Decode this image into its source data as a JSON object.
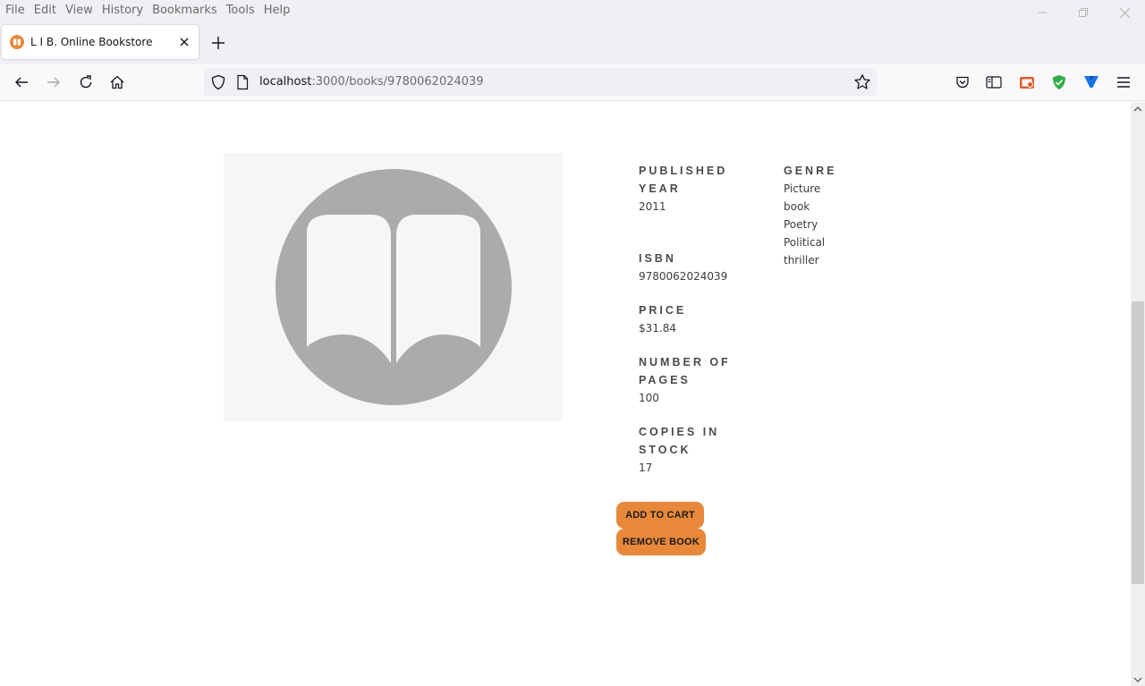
{
  "menu": [
    "File",
    "Edit",
    "View",
    "History",
    "Bookmarks",
    "Tools",
    "Help"
  ],
  "tab": {
    "title": "L I B. Online Bookstore"
  },
  "url": {
    "host": "localhost",
    "path": ":3000/books/9780062024039"
  },
  "book": {
    "published_year_label": "PUBLISHED YEAR",
    "published_year": "2011",
    "isbn_label": "ISBN",
    "isbn": "9780062024039",
    "price_label": "PRICE",
    "price": "$31.84",
    "pages_label": "NUMBER OF PAGES",
    "pages": "100",
    "stock_label": "COPIES IN STOCK",
    "stock": "17",
    "genre_label": "GENRE",
    "genres": [
      "Picture book",
      "Poetry",
      "Political thriller"
    ]
  },
  "actions": {
    "add_to_cart": "ADD TO CART",
    "remove_book": "REMOVE BOOK"
  },
  "colors": {
    "accent": "#e8883a",
    "cover_bg": "#f6f6f6",
    "cover_icon": "#ababab"
  },
  "icons": {
    "favicon": "book-logo-icon",
    "tab_close": "close-icon",
    "new_tab": "plus-icon",
    "back": "arrow-left-icon",
    "forward": "arrow-right-icon",
    "reload": "reload-icon",
    "home": "home-icon",
    "tracking": "shield-icon",
    "page_info": "page-icon",
    "bookmark": "star-icon",
    "pocket": "pocket-icon",
    "reader": "sidebar-icon",
    "ext1": "extension-red-icon",
    "ext2": "shield-check-icon",
    "ext3": "extension-blue-icon",
    "app_menu": "hamburger-icon",
    "cover": "open-book-icon"
  }
}
